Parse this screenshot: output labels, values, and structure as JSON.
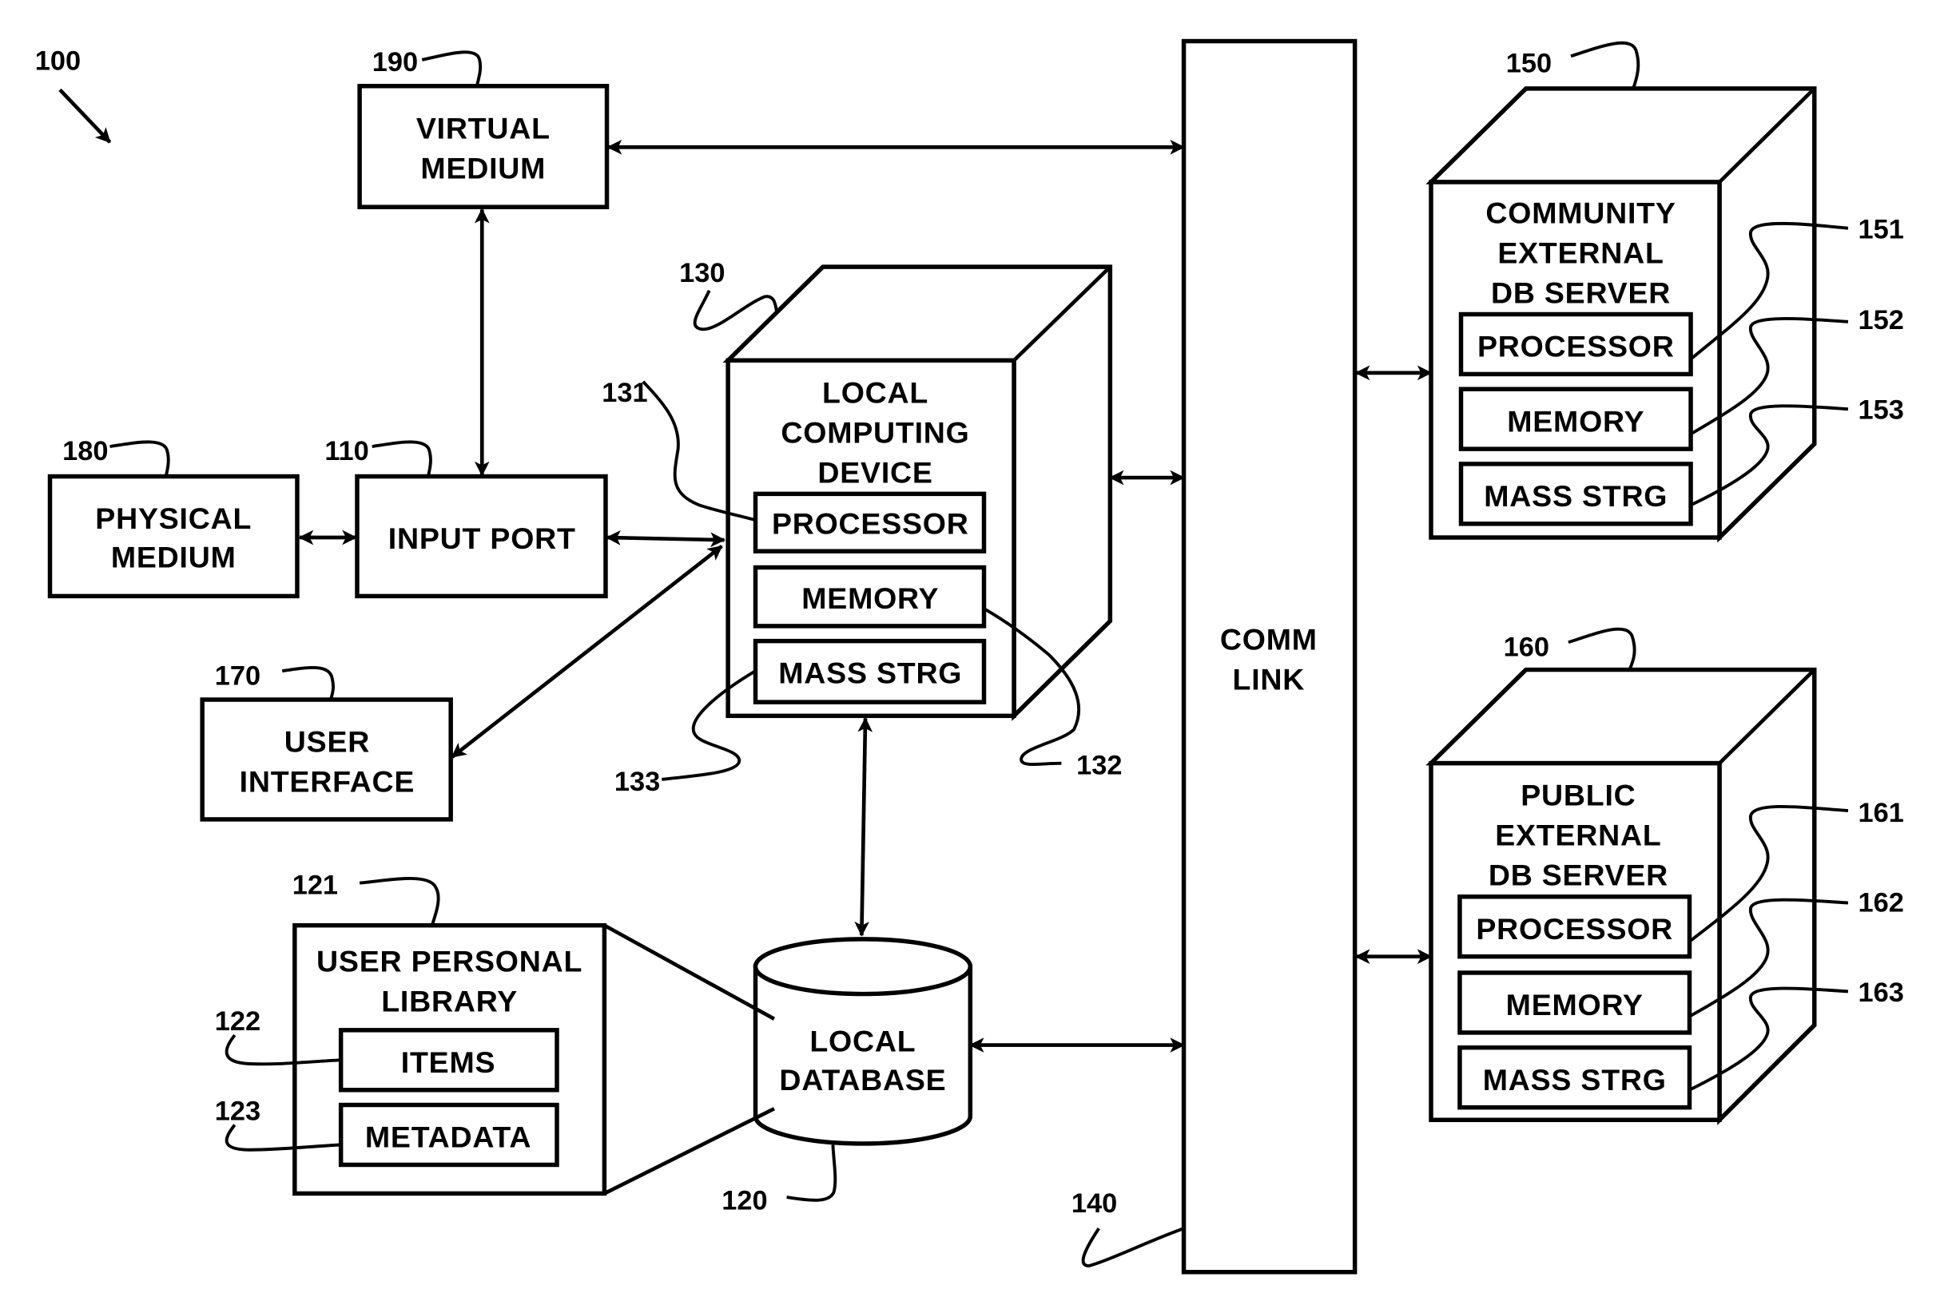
{
  "figure": {
    "ref": "100",
    "colors": {
      "stroke": "#000000",
      "background": "#ffffff"
    },
    "nodes": {
      "virtual_medium": {
        "ref": "190",
        "lines": [
          "VIRTUAL",
          "MEDIUM"
        ]
      },
      "physical_medium": {
        "ref": "180",
        "lines": [
          "PHYSICAL",
          "MEDIUM"
        ]
      },
      "input_port": {
        "ref": "110",
        "lines": [
          "INPUT PORT"
        ]
      },
      "user_interface": {
        "ref": "170",
        "lines": [
          "USER",
          "INTERFACE"
        ]
      },
      "local_computing_device": {
        "ref": "130",
        "lines": [
          "LOCAL",
          "COMPUTING",
          "DEVICE"
        ],
        "components": [
          {
            "ref": "131",
            "label": "PROCESSOR"
          },
          {
            "ref": "132",
            "label": "MEMORY"
          },
          {
            "ref": "133",
            "label": "MASS STRG"
          }
        ]
      },
      "local_database": {
        "ref": "120",
        "lines": [
          "LOCAL",
          "DATABASE"
        ]
      },
      "user_personal_library": {
        "ref": "121",
        "lines": [
          "USER PERSONAL",
          "LIBRARY"
        ],
        "components": [
          {
            "ref": "122",
            "label": "ITEMS"
          },
          {
            "ref": "123",
            "label": "METADATA"
          }
        ]
      },
      "comm_link": {
        "ref": "140",
        "lines": [
          "COMM",
          "LINK"
        ]
      },
      "community_server": {
        "ref": "150",
        "lines": [
          "COMMUNITY",
          "EXTERNAL",
          "DB SERVER"
        ],
        "components": [
          {
            "ref": "151",
            "label": "PROCESSOR"
          },
          {
            "ref": "152",
            "label": "MEMORY"
          },
          {
            "ref": "153",
            "label": "MASS STRG"
          }
        ]
      },
      "public_server": {
        "ref": "160",
        "lines": [
          "PUBLIC",
          "EXTERNAL",
          "DB SERVER"
        ],
        "components": [
          {
            "ref": "161",
            "label": "PROCESSOR"
          },
          {
            "ref": "162",
            "label": "MEMORY"
          },
          {
            "ref": "163",
            "label": "MASS STRG"
          }
        ]
      }
    },
    "connections": [
      {
        "from": "VIRTUAL MEDIUM",
        "to": "COMM LINK",
        "type": "bidirectional"
      },
      {
        "from": "VIRTUAL MEDIUM",
        "to": "INPUT PORT",
        "type": "bidirectional"
      },
      {
        "from": "PHYSICAL MEDIUM",
        "to": "INPUT PORT",
        "type": "bidirectional"
      },
      {
        "from": "INPUT PORT",
        "to": "LOCAL COMPUTING DEVICE",
        "type": "bidirectional"
      },
      {
        "from": "USER INTERFACE",
        "to": "LOCAL COMPUTING DEVICE",
        "type": "bidirectional"
      },
      {
        "from": "LOCAL COMPUTING DEVICE",
        "to": "COMM LINK",
        "type": "bidirectional"
      },
      {
        "from": "LOCAL COMPUTING DEVICE",
        "to": "LOCAL DATABASE",
        "type": "bidirectional"
      },
      {
        "from": "LOCAL DATABASE",
        "to": "COMM LINK",
        "type": "bidirectional"
      },
      {
        "from": "COMM LINK",
        "to": "COMMUNITY EXTERNAL DB SERVER",
        "type": "bidirectional"
      },
      {
        "from": "COMM LINK",
        "to": "PUBLIC EXTERNAL DB SERVER",
        "type": "bidirectional"
      }
    ]
  }
}
